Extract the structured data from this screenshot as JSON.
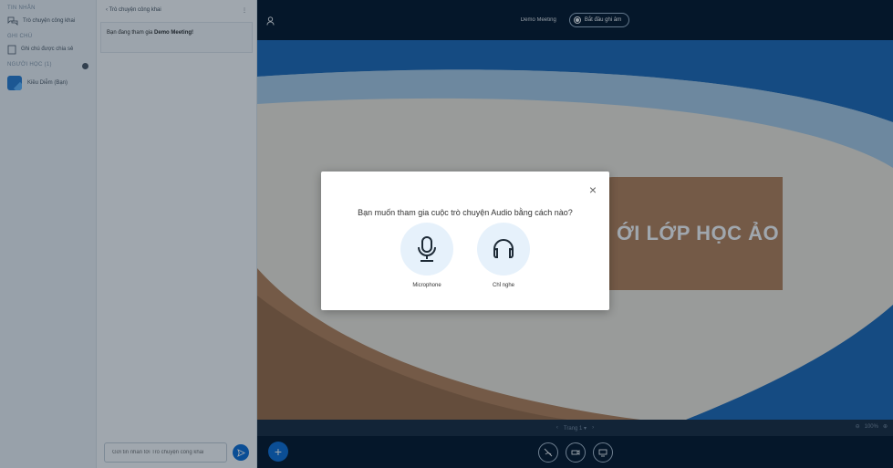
{
  "userlist": {
    "messages_label": "Tin nhắn",
    "public_chat": "Trò chuyện công khai",
    "notes_label": "Ghi chú",
    "shared_notes": "Ghi chú được chia sẻ",
    "users_label": "Người học (1)",
    "user_name": "Kiều Diễm (Bạn)"
  },
  "chat": {
    "title": "Trò chuyện công khai",
    "welcome_prefix": "Bạn đang tham gia ",
    "welcome_meeting": "Demo Meeting!",
    "input_placeholder": "Gửi tin nhắn tới Trò chuyện công khai"
  },
  "topbar": {
    "meeting_title": "Demo Meeting",
    "record_label": "Bắt đầu ghi âm"
  },
  "slide": {
    "banner_text": "ỚI LỚP HỌC ẢO"
  },
  "slidebar": {
    "page_label": "Trang 1",
    "zoom_value": "100%"
  },
  "modal": {
    "close": "×",
    "title": "Bạn muốn tham gia cuộc trò chuyện Audio bằng cách nào?",
    "option_microphone": "Microphone",
    "option_listen": "Chỉ nghe"
  },
  "colors": {
    "primary": "#0f70d7",
    "dark_bg": "#06172a",
    "banner": "#b8845a",
    "option_bg": "#e6f1fb"
  }
}
